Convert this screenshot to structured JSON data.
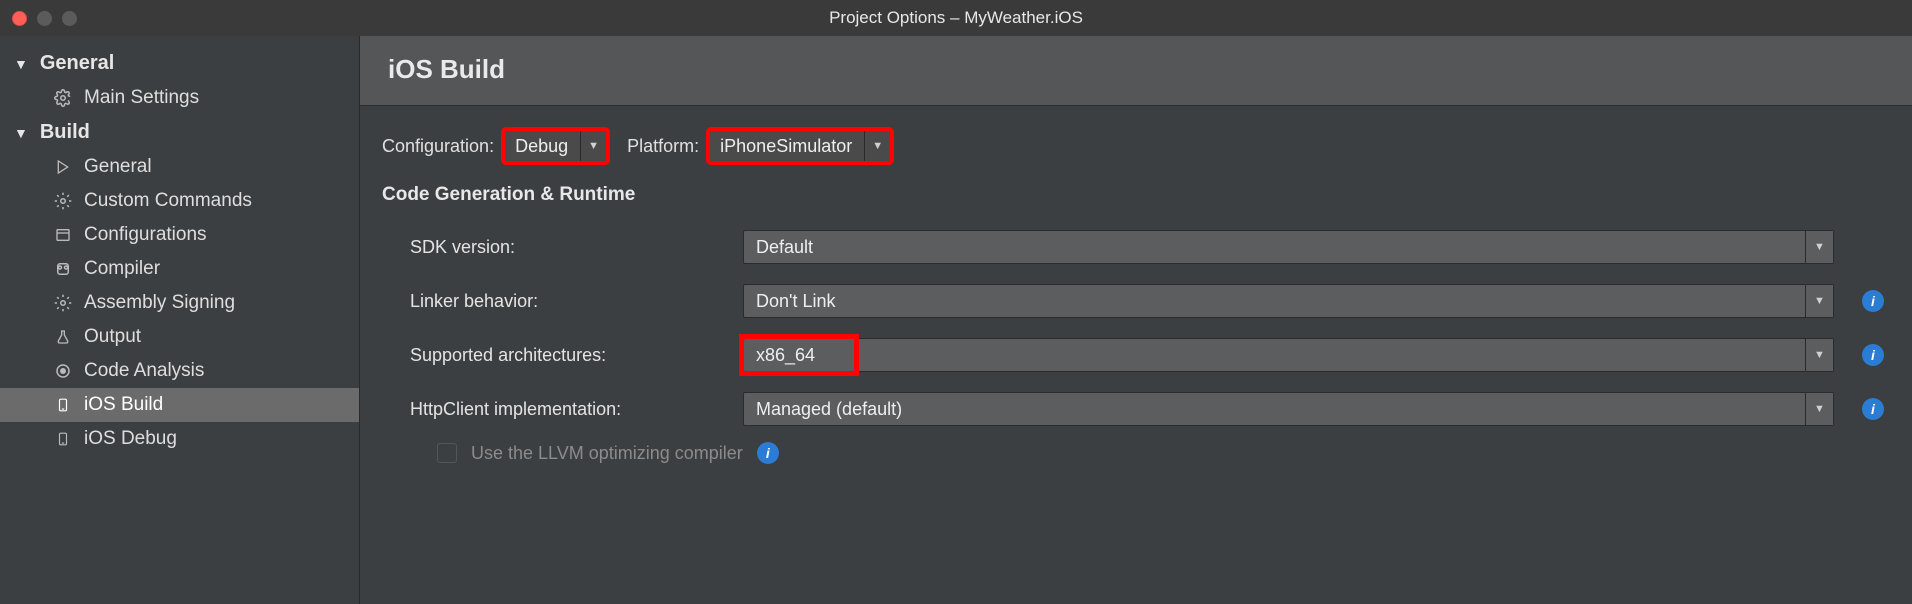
{
  "window": {
    "title": "Project Options – MyWeather.iOS"
  },
  "sidebar": {
    "categories": [
      {
        "label": "General",
        "items": [
          {
            "icon": "gear",
            "label": "Main Settings"
          }
        ]
      },
      {
        "label": "Build",
        "items": [
          {
            "icon": "play",
            "label": "General"
          },
          {
            "icon": "gear",
            "label": "Custom Commands"
          },
          {
            "icon": "window",
            "label": "Configurations"
          },
          {
            "icon": "chip",
            "label": "Compiler"
          },
          {
            "icon": "gear",
            "label": "Assembly Signing"
          },
          {
            "icon": "flask",
            "label": "Output"
          },
          {
            "icon": "target",
            "label": "Code Analysis"
          },
          {
            "icon": "phone",
            "label": "iOS Build",
            "selected": true
          },
          {
            "icon": "phone",
            "label": "iOS Debug"
          }
        ]
      }
    ]
  },
  "main": {
    "header": "iOS Build",
    "config": {
      "configuration_label": "Configuration:",
      "configuration_value": "Debug",
      "platform_label": "Platform:",
      "platform_value": "iPhoneSimulator"
    },
    "section_title": "Code Generation & Runtime",
    "rows": {
      "sdk_label": "SDK version:",
      "sdk_value": "Default",
      "linker_label": "Linker behavior:",
      "linker_value": "Don't Link",
      "arch_label": "Supported architectures:",
      "arch_value": "x86_64",
      "http_label": "HttpClient implementation:",
      "http_value": "Managed (default)"
    },
    "llvm_checkbox_label": "Use the LLVM optimizing compiler"
  }
}
